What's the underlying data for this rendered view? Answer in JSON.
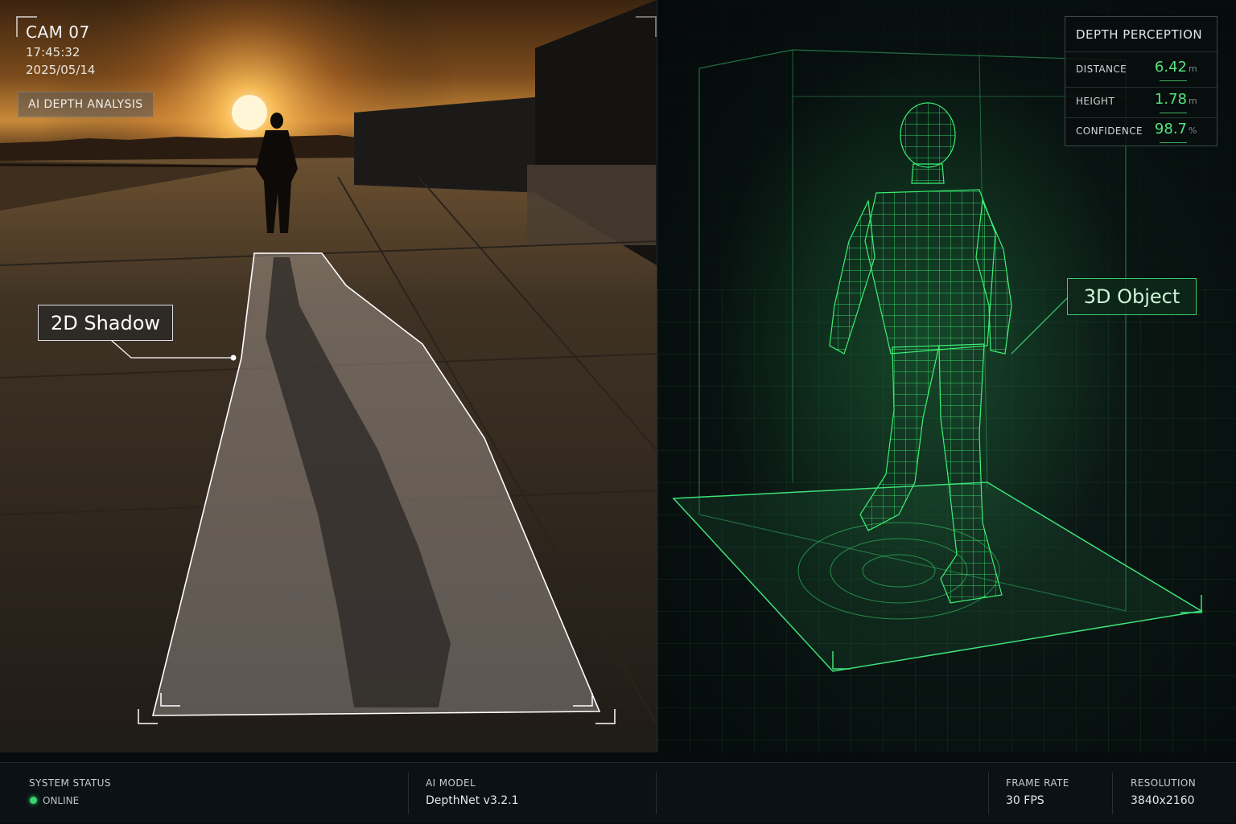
{
  "camera": {
    "title": "CAM 07",
    "time": "17:45:32",
    "date": "2025/05/14",
    "badge": "AI DEPTH ANALYSIS"
  },
  "annotations": {
    "shadow_label": "2D Shadow",
    "object_label": "3D Object"
  },
  "depth_panel": {
    "title": "DEPTH PERCEPTION",
    "rows": [
      {
        "label": "DISTANCE",
        "value": "6.42",
        "unit": "m"
      },
      {
        "label": "HEIGHT",
        "value": "1.78",
        "unit": "m"
      },
      {
        "label": "CONFIDENCE",
        "value": "98.7",
        "unit": "%"
      }
    ]
  },
  "status_bar": {
    "system_status": {
      "label": "SYSTEM STATUS",
      "value": "ONLINE"
    },
    "ai_model": {
      "label": "AI MODEL",
      "value": "DepthNet v3.2.1"
    },
    "frame_rate": {
      "label": "FRAME RATE",
      "value": "30 FPS"
    },
    "resolution": {
      "label": "RESOLUTION",
      "value": "3840x2160"
    }
  },
  "colors": {
    "accent_green": "#53e57e",
    "wireframe_green": "#2fd060",
    "sunset_orange": "#f0a040"
  },
  "icons": {
    "status_indicator": "green-dot-icon"
  }
}
